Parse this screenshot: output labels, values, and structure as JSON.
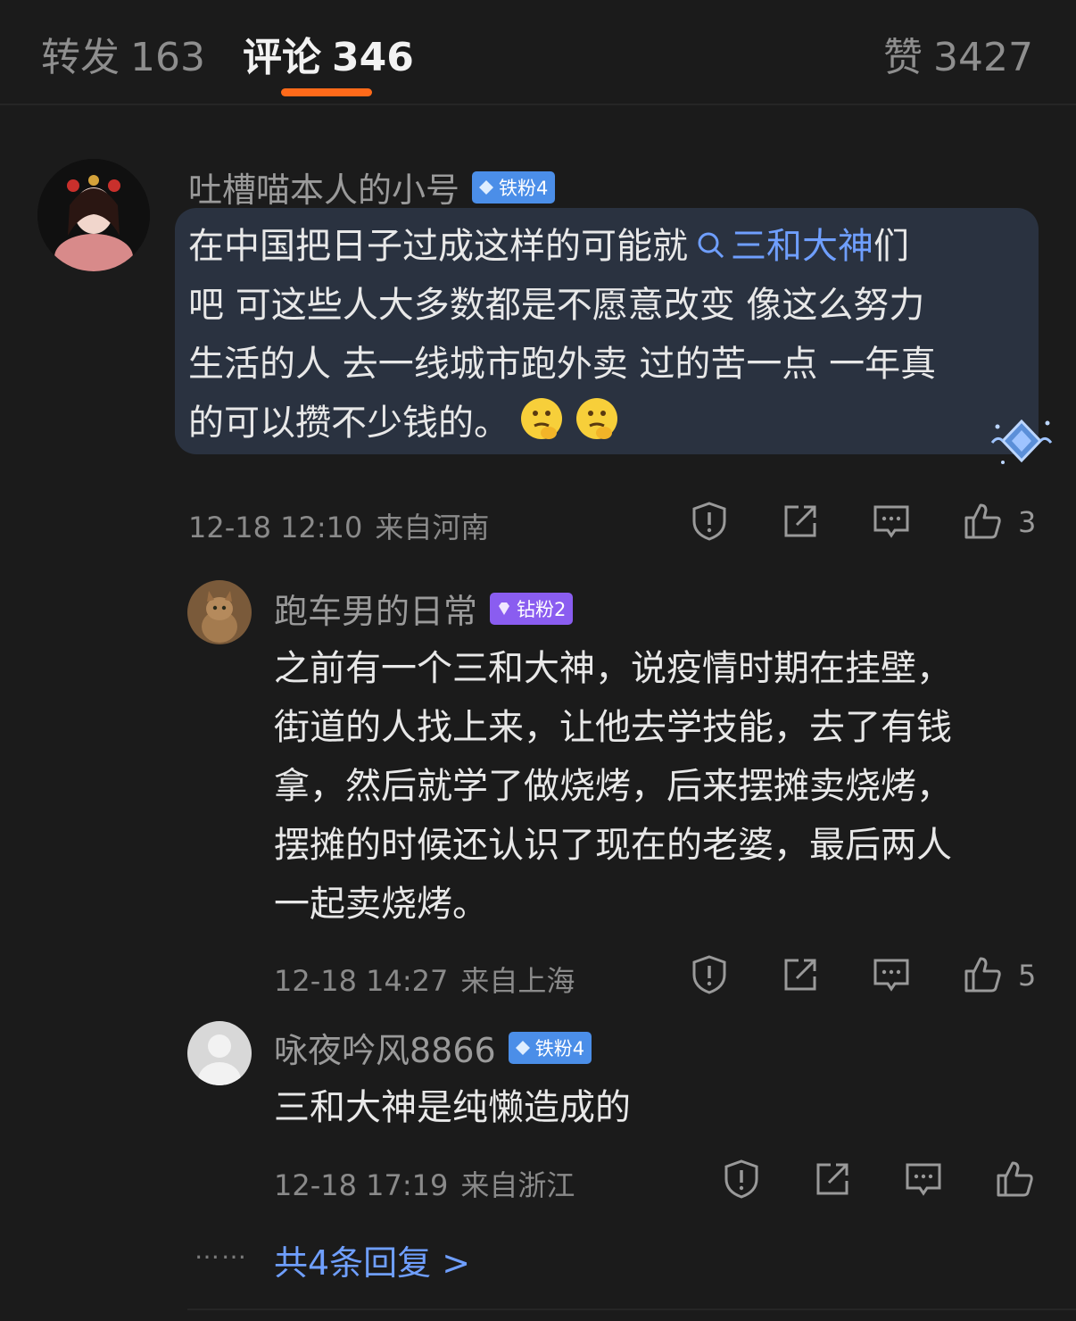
{
  "tabs": {
    "repost_label": "转发",
    "repost_count": "163",
    "comments_label": "评论",
    "comments_count": "346",
    "likes_label": "赞",
    "likes_count": "3427"
  },
  "comment": {
    "author": "吐槽喵本人的小号",
    "badge": "铁粉4",
    "line1_prefix": "在中国把日子过成这样的可能就",
    "topic": "三和大神",
    "line1_suffix": "们",
    "line2": "吧 可这些人大多数都是不愿意改变 像这么努力",
    "line3": "生活的人 去一线城市跑外卖 过的苦一点 一年真",
    "line4": "的可以攒不少钱的。",
    "emoji": "thinking-face",
    "time": "12-18 12:10",
    "location": "来自河南",
    "likes": "3"
  },
  "replies": [
    {
      "author": "跑车男的日常",
      "badge": "钻粉2",
      "lines": [
        "之前有一个三和大神，说疫情时期在挂壁，",
        "街道的人找上来，让他去学技能，去了有钱",
        "拿，然后就学了做烧烤，后来摆摊卖烧烤，",
        "摆摊的时候还认识了现在的老婆，最后两人",
        "一起卖烧烤。"
      ],
      "time": "12-18 14:27",
      "location": "来自上海",
      "likes": "5"
    },
    {
      "author": "咏夜吟风8866",
      "badge": "铁粉4",
      "lines": [
        "三和大神是纯懒造成的"
      ],
      "time": "12-18 17:19",
      "location": "来自浙江",
      "likes": ""
    }
  ],
  "more_dots": "……",
  "more_replies": "共4条回复 >",
  "colors": {
    "accent": "#ff6a1a",
    "link": "#6f9fff",
    "badge_blue": "#4b8ee8",
    "badge_purple": "#8a5df0"
  }
}
